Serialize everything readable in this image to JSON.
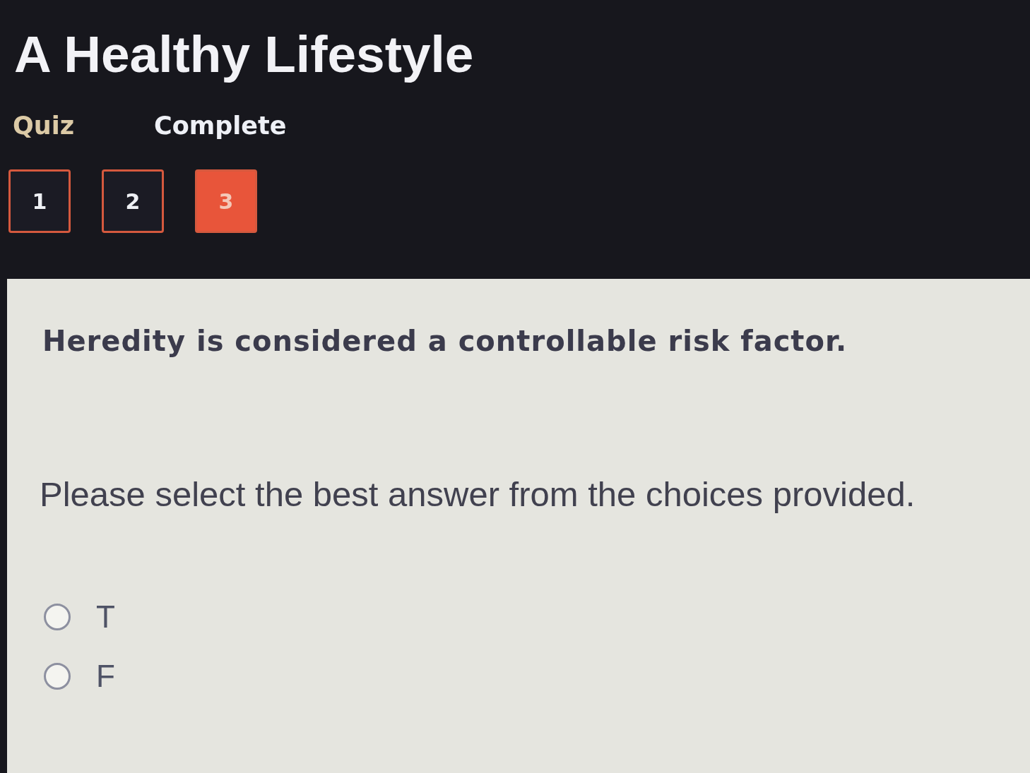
{
  "title": "A Healthy Lifestyle",
  "tabs": [
    {
      "label": "Quiz",
      "selected": true
    },
    {
      "label": "Complete",
      "selected": false
    }
  ],
  "questions": [
    {
      "label": "1",
      "selected": false
    },
    {
      "label": "2",
      "selected": false
    },
    {
      "label": "3",
      "selected": true
    }
  ],
  "question": {
    "text": "Heredity is considered a controllable risk factor.",
    "instruction": "Please select the best answer from the choices provided.",
    "options": [
      {
        "label": "T",
        "selected": false
      },
      {
        "label": "F",
        "selected": false
      }
    ]
  }
}
